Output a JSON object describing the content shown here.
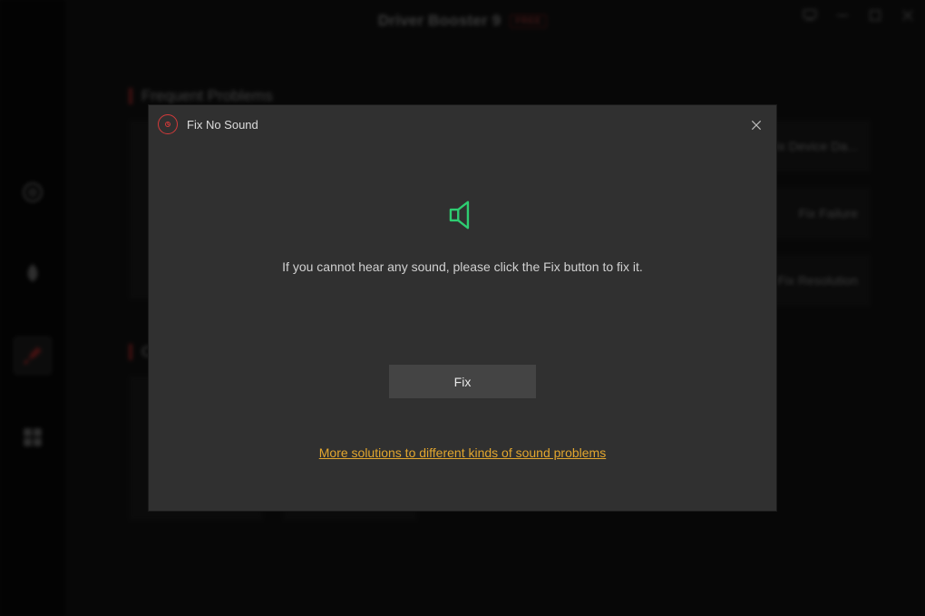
{
  "titlebar": {
    "app_name": "Driver Booster 9",
    "badge": "FREE"
  },
  "bg": {
    "section1_label": "Frequent Problems",
    "section2_label": "Other Tools",
    "right_tiles": [
      "Fix Device Da...",
      "Fix Failure",
      "Fix Resolution"
    ]
  },
  "modal": {
    "title": "Fix No Sound",
    "message": "If you cannot hear any sound, please click the Fix button to fix it.",
    "fix_button": "Fix",
    "more_link": "More solutions to different kinds of sound problems"
  }
}
